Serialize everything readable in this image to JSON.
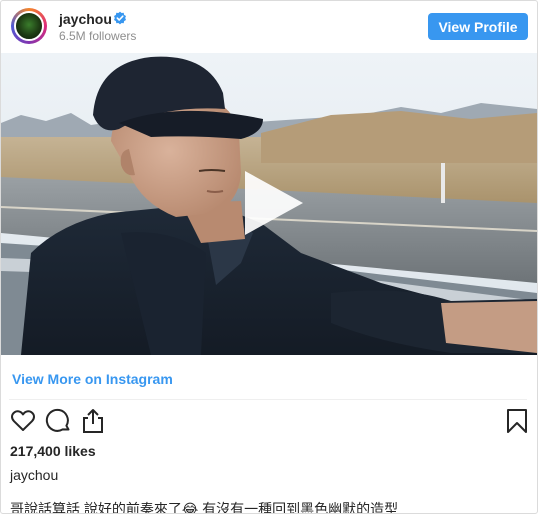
{
  "header": {
    "username": "jaychou",
    "verified_icon": "verified-badge-icon",
    "followers": "6.5M followers",
    "view_profile_label": "View Profile"
  },
  "media": {
    "type": "video",
    "play_icon": "play-icon"
  },
  "view_more_label": "View More on Instagram",
  "actions": {
    "like_icon": "heart-icon",
    "comment_icon": "comment-icon",
    "share_icon": "share-icon",
    "save_icon": "bookmark-icon"
  },
  "likes": "217,400 likes",
  "caption": {
    "username": "jaychou",
    "text_part1": "哥說話算話 說好的前奏來了",
    "emoji": "😂",
    "text_part2": " 有沒有一種回到黑色幽默的造型"
  },
  "colors": {
    "accent": "#3897f0",
    "text": "#262626",
    "muted": "#8e8e8e"
  }
}
